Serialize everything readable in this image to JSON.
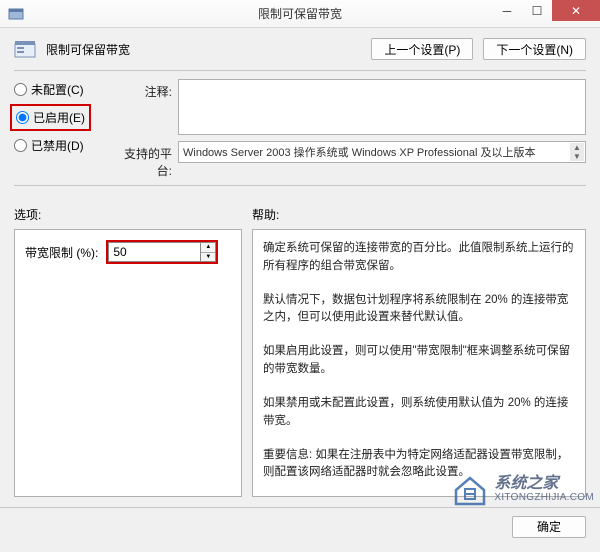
{
  "window": {
    "title": "限制可保留带宽"
  },
  "header": {
    "policy_name": "限制可保留带宽",
    "prev_btn": "上一个设置(P)",
    "next_btn": "下一个设置(N)"
  },
  "radios": {
    "not_configured": "未配置(C)",
    "enabled": "已启用(E)",
    "disabled": "已禁用(D)",
    "selected": "enabled"
  },
  "fields": {
    "comment_label": "注释:",
    "comment_value": "",
    "platform_label": "支持的平台:",
    "platform_value": "Windows Server 2003 操作系统或 Windows XP Professional 及以上版本"
  },
  "sections": {
    "options_label": "选项:",
    "help_label": "帮助:"
  },
  "options": {
    "bandwidth_label": "带宽限制 (%):",
    "bandwidth_value": "50"
  },
  "help": {
    "p1": "确定系统可保留的连接带宽的百分比。此值限制系统上运行的所有程序的组合带宽保留。",
    "p2": "默认情况下，数据包计划程序将系统限制在 20% 的连接带宽之内，但可以使用此设置来替代默认值。",
    "p3": "如果启用此设置，则可以使用\"带宽限制\"框来调整系统可保留的带宽数量。",
    "p4": "如果禁用或未配置此设置，则系统使用默认值为 20% 的连接带宽。",
    "p5": "重要信息: 如果在注册表中为特定网络适配器设置带宽限制，则配置该网络适配器时就会忽略此设置。"
  },
  "footer": {
    "ok": "确定"
  },
  "watermark": {
    "name": "系统之家",
    "url": "XITONGZHIJIA.COM"
  }
}
